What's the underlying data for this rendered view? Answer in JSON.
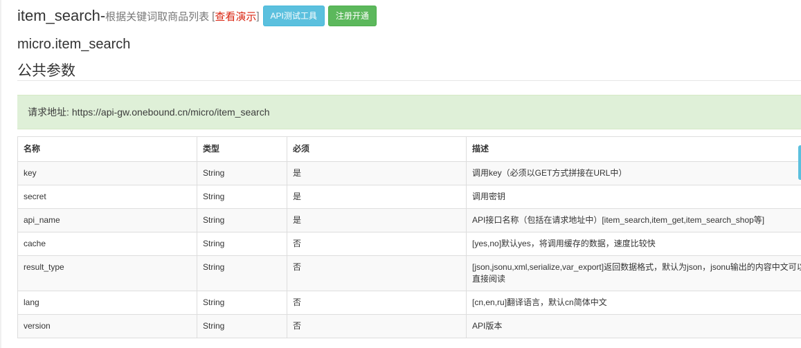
{
  "header": {
    "title": "item_search-",
    "subtitle": "根据关键词取商品列表",
    "bracket_open": "[",
    "demo_link": "查看演示",
    "bracket_close": "]",
    "btn_api_test": "API测试工具",
    "btn_register": "注册开通"
  },
  "api_name": "micro.item_search",
  "section_title": "公共参数",
  "request": {
    "label": "请求地址:",
    "url": "https://api-gw.onebound.cn/micro/item_search"
  },
  "table": {
    "headers": [
      "名称",
      "类型",
      "必须",
      "描述"
    ],
    "rows": [
      {
        "name": "key",
        "type": "String",
        "required": "是",
        "desc": "调用key（必须以GET方式拼接在URL中）"
      },
      {
        "name": "secret",
        "type": "String",
        "required": "是",
        "desc": "调用密钥"
      },
      {
        "name": "api_name",
        "type": "String",
        "required": "是",
        "desc": "API接口名称（包括在请求地址中）[item_search,item_get,item_search_shop等]"
      },
      {
        "name": "cache",
        "type": "String",
        "required": "否",
        "desc": "[yes,no]默认yes，将调用缓存的数据，速度比较快"
      },
      {
        "name": "result_type",
        "type": "String",
        "required": "否",
        "desc": "[json,jsonu,xml,serialize,var_export]返回数据格式，默认为json，jsonu输出的内容中文可以直接阅读"
      },
      {
        "name": "lang",
        "type": "String",
        "required": "否",
        "desc": "[cn,en,ru]翻译语言，默认cn简体中文"
      },
      {
        "name": "version",
        "type": "String",
        "required": "否",
        "desc": "API版本"
      }
    ]
  }
}
